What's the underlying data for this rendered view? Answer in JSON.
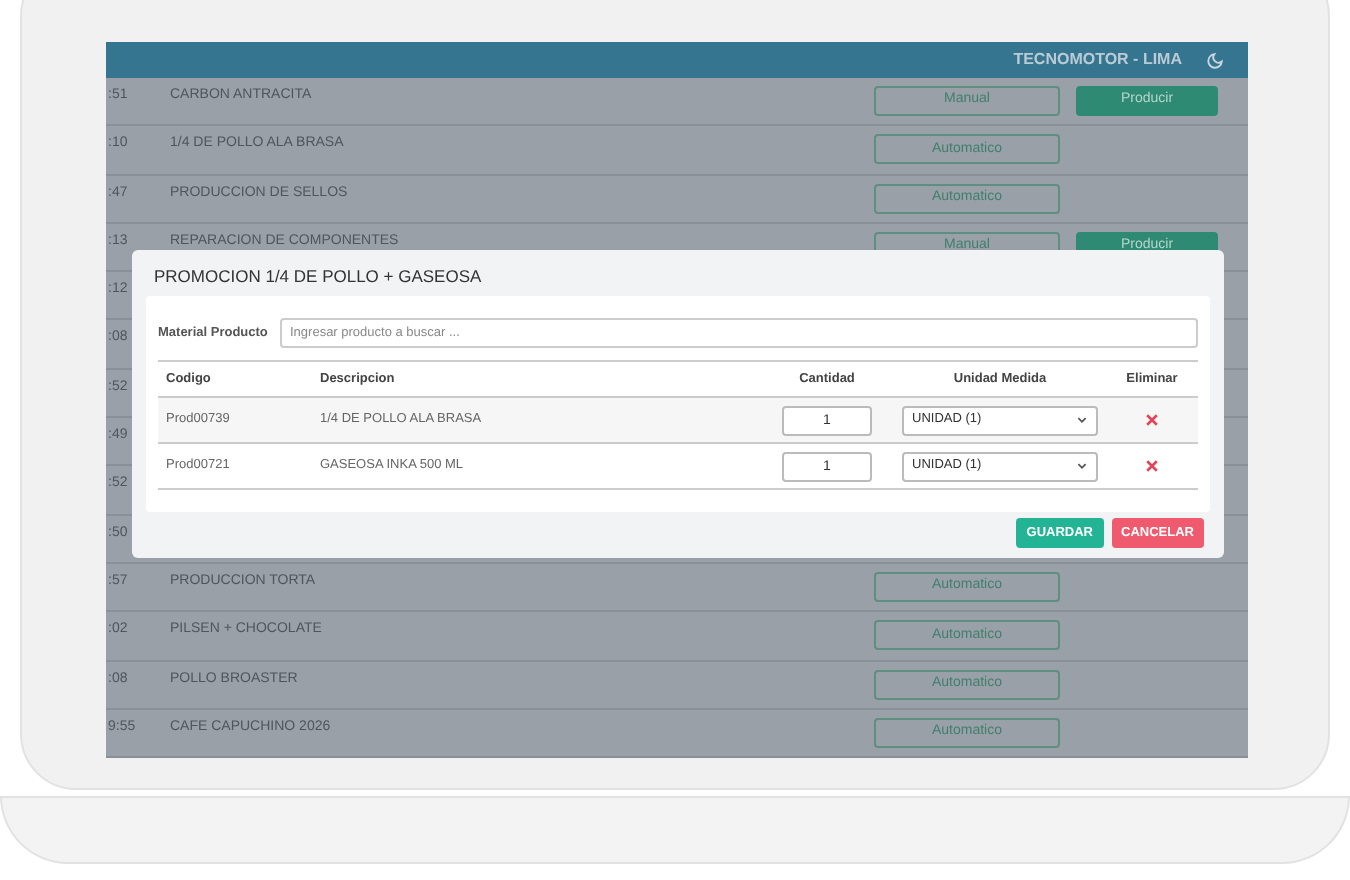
{
  "header": {
    "title": "TECNOMOTOR - LIMA"
  },
  "rows": [
    {
      "time": ":51",
      "name": "CARBON ANTRACITA",
      "mode": "Manual",
      "produce": "Producir"
    },
    {
      "time": ":10",
      "name": "1/4 DE POLLO ALA BRASA",
      "mode": "Automatico"
    },
    {
      "time": ":47",
      "name": "PRODUCCION DE SELLOS",
      "mode": "Automatico"
    },
    {
      "time": ":13",
      "name": "REPARACION DE COMPONENTES",
      "mode": "Manual",
      "produce": "Producir"
    },
    {
      "time": ":12"
    },
    {
      "time": ":08"
    },
    {
      "time": ":52"
    },
    {
      "time": ":49"
    },
    {
      "time": ":52"
    },
    {
      "time": ":50"
    },
    {
      "time": ":57",
      "name": "PRODUCCION TORTA",
      "mode": "Automatico"
    },
    {
      "time": ":02",
      "name": "PILSEN + CHOCOLATE",
      "mode": "Automatico"
    },
    {
      "time": ":08",
      "name": "POLLO BROASTER",
      "mode": "Automatico"
    },
    {
      "time": "9:55",
      "name": "CAFE CAPUCHINO 2026",
      "mode": "Automatico"
    }
  ],
  "modal": {
    "title": "PROMOCION 1/4 DE POLLO + GASEOSA",
    "search_label": "Material Producto",
    "search_placeholder": "Ingresar producto a buscar ...",
    "columns": [
      "Codigo",
      "Descripcion",
      "Cantidad",
      "Unidad Medida",
      "Eliminar"
    ],
    "items": [
      {
        "code": "Prod00739",
        "description": "1/4 DE POLLO ALA BRASA",
        "quantity": "1",
        "unit": "UNIDAD (1)"
      },
      {
        "code": "Prod00721",
        "description": "GASEOSA INKA 500 ML",
        "quantity": "1",
        "unit": "UNIDAD (1)"
      }
    ],
    "save": "GUARDAR",
    "cancel": "CANCELAR"
  }
}
